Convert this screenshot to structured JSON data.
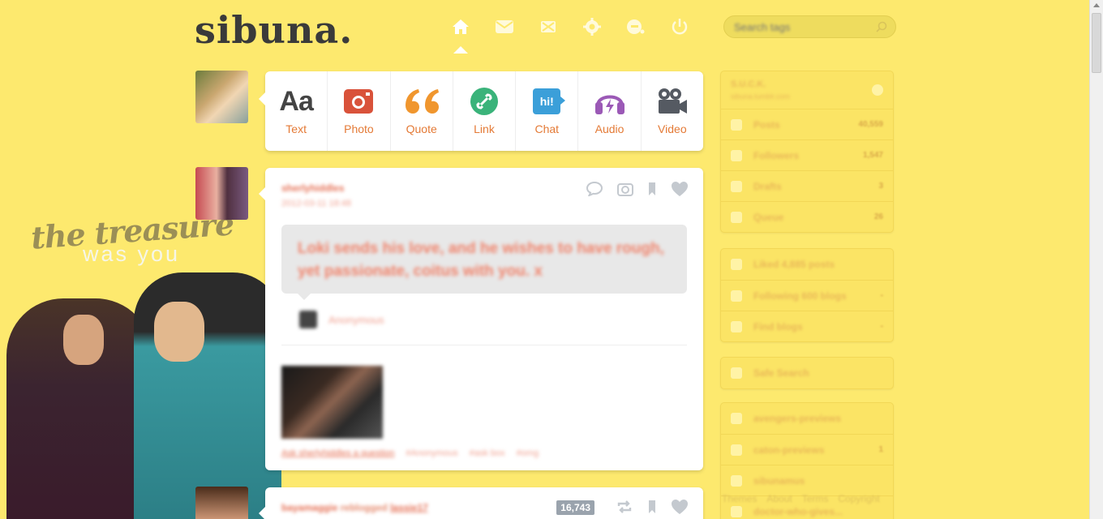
{
  "header": {
    "logo": "sibuna.",
    "search_placeholder": "Search tags",
    "nav": [
      "home-icon",
      "mail-icon",
      "compass-icon",
      "gear-icon",
      "help-icon",
      "power-icon"
    ]
  },
  "composer": {
    "types": [
      {
        "label": "Text",
        "glyph": "Aa",
        "color": "#444444"
      },
      {
        "label": "Photo",
        "color": "#d9523a"
      },
      {
        "label": "Quote",
        "glyph": "66",
        "color": "#f0962e"
      },
      {
        "label": "Link",
        "color": "#3ab37a"
      },
      {
        "label": "Chat",
        "glyph": "hi!",
        "color": "#3b9fd9"
      },
      {
        "label": "Audio",
        "color": "#9b59b6"
      },
      {
        "label": "Video",
        "color": "#555a62"
      }
    ]
  },
  "post1": {
    "username": "sherlyhiddles",
    "date": "2012-03-11 18:48",
    "question": "Loki sends his love, and he wishes to have rough, yet passionate, coitus with you. x",
    "asker": "Anonymous",
    "ask_link": "Ask sherlyhiddles a question",
    "tags": [
      "#Anonymous",
      "#ask box",
      "#omg"
    ]
  },
  "post2": {
    "username": "bayamaggie",
    "action": "reblogged",
    "source": "lassie17",
    "notes": "16,743"
  },
  "sidebar": {
    "blog_title": "S.U.C.K.",
    "blog_subtitle": "sibuna.tumblr.com",
    "stats": [
      {
        "label": "Posts",
        "count": "40,559"
      },
      {
        "label": "Followers",
        "count": "1,547"
      },
      {
        "label": "Drafts",
        "count": "3"
      },
      {
        "label": "Queue",
        "count": "26"
      }
    ],
    "activity": [
      {
        "label": "Liked 4,885 posts",
        "count": ""
      },
      {
        "label": "Following 600 blogs",
        "count": "-"
      },
      {
        "label": "Find blogs",
        "count": "-"
      }
    ],
    "misc": [
      {
        "label": "Safe Search",
        "count": ""
      }
    ],
    "blogs": [
      {
        "label": "avengers-previews",
        "count": ""
      },
      {
        "label": "caton-previews",
        "count": "1"
      },
      {
        "label": "sibunamus",
        "count": ""
      },
      {
        "label": "doctor-who-gives...",
        "count": ""
      }
    ]
  },
  "footer": [
    "Themes",
    "About",
    "Terms",
    "Copyright"
  ],
  "decoration": {
    "line1": "the treasure",
    "line2": "was you"
  }
}
